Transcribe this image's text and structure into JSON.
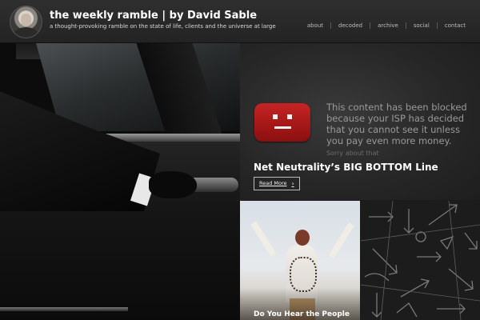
{
  "header": {
    "title": "the weekly ramble | by David Sable",
    "tagline": "a thought-provoking ramble on the state of life, clients and the universe at large",
    "avatar_icon": "author-avatar",
    "nav": [
      {
        "label": "about"
      },
      {
        "label": "decoded"
      },
      {
        "label": "archive"
      },
      {
        "label": "social"
      },
      {
        "label": "contact"
      }
    ]
  },
  "featured": {
    "blocked_message": "This content has been blocked because your ISP has decided that you cannot see it unless you pay even more money.",
    "blocked_sub": "Sorry about that",
    "blocked_icon": "blocked-video-icon",
    "post_title": "Net Neutrality’s BIG BOTTOM Line",
    "read_more": "Read More",
    "read_more_icon": "chevron-right-icon",
    "read_more_glyph": "›"
  },
  "tiles": [
    {
      "caption": "Do You Hear the People"
    }
  ],
  "colors": {
    "header_bg": "#2a2a2a",
    "blocked_red": "#c62424",
    "text_grey": "#9a9a9a"
  }
}
